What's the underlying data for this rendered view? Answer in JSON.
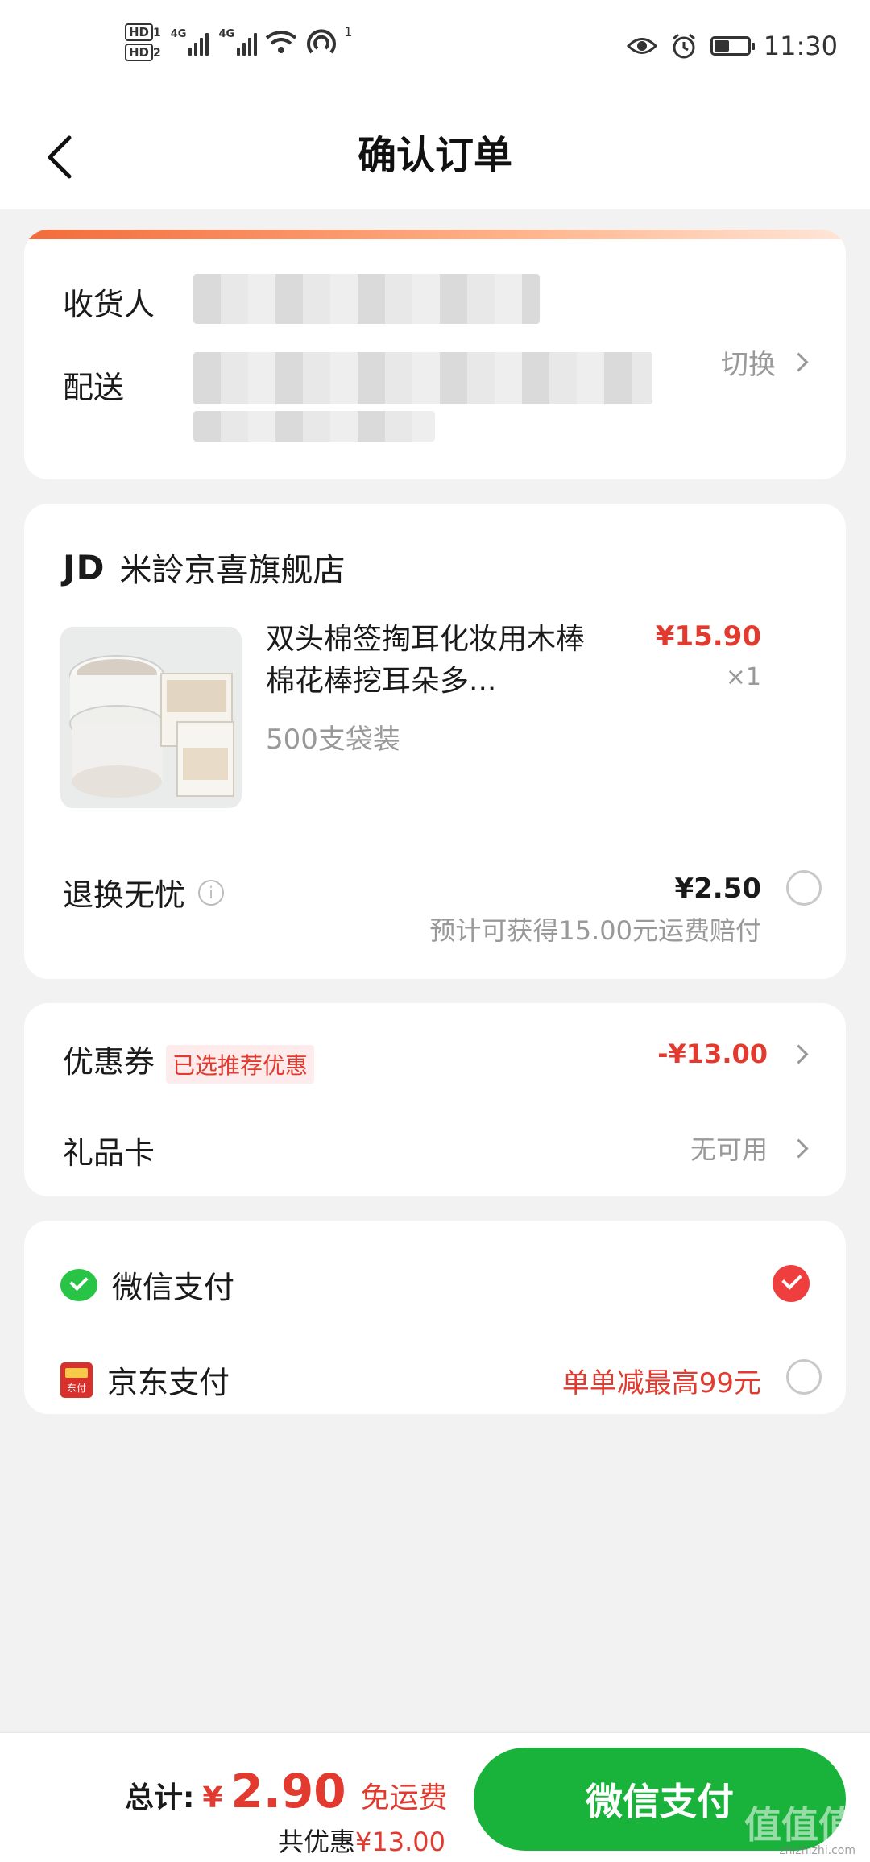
{
  "status_bar": {
    "hd1": "HD",
    "hd1_sub": "1",
    "hd2": "HD",
    "hd2_sub": "2",
    "net1": "4G",
    "net2": "4G",
    "hotspot_count": "1",
    "time": "11:30",
    "battery_level": 0.45
  },
  "nav": {
    "title": "确认订单"
  },
  "address": {
    "recipient_label": "收货人",
    "delivery_label": "配送",
    "switch_label": "切换"
  },
  "shop": {
    "logo": "JD",
    "name": "米詅京喜旗舰店"
  },
  "product": {
    "name": "双头棉签掏耳化妆用木棒棉花棒挖耳朵多...",
    "spec": "500支袋装",
    "price": "¥15.90",
    "qty": "×1"
  },
  "return_service": {
    "label": "退换无忧",
    "price": "¥2.50",
    "note": "预计可获得15.00元运费赔付"
  },
  "coupon": {
    "label": "优惠券",
    "tag": "已选推荐优惠",
    "value": "-¥13.00"
  },
  "gift_card": {
    "label": "礼品卡",
    "value": "无可用"
  },
  "payment": {
    "wechat_label": "微信支付",
    "jd_label": "京东支付",
    "jd_icon_text": "东付",
    "jd_promo": "单单减最高99元"
  },
  "bottom_bar": {
    "total_label": "总计:",
    "currency": "¥",
    "total_amount": "2.90",
    "shipping": "免运费",
    "discount_label": "共优惠",
    "discount_value": "¥13.00",
    "pay_button": "微信支付"
  },
  "watermark": {
    "text": "值值值",
    "sub": "zhizhizhi.com"
  },
  "colors": {
    "accent_red": "#e23a2e",
    "wechat_green": "#19b23b",
    "check_red": "#ef3e3e"
  }
}
